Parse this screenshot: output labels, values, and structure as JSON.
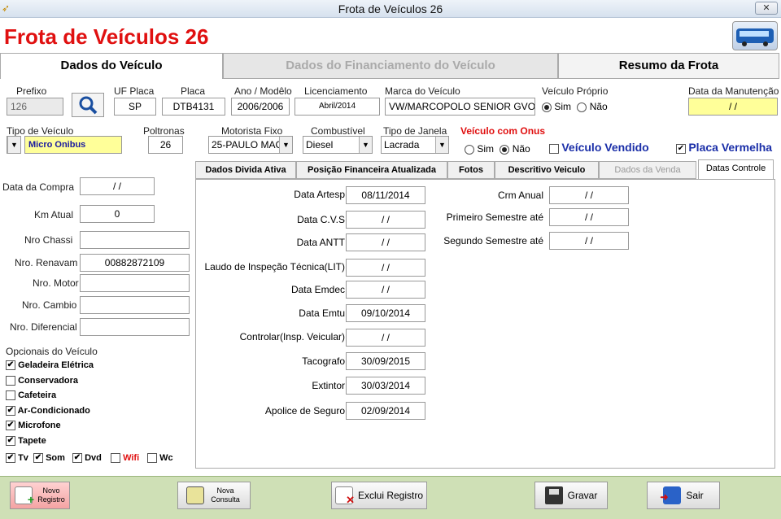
{
  "window": {
    "title": "Frota de Veículos 26",
    "close": "✕"
  },
  "app": {
    "title": "Frota de Veículos 26"
  },
  "tabs": [
    "Dados do Veículo",
    "Dados do Financiamento do Veículo",
    "Resumo da Frota"
  ],
  "header": {
    "prefixo_label": "Prefixo",
    "prefixo": "126",
    "uf_label": "UF Placa",
    "uf": "SP",
    "placa_label": "Placa",
    "placa": "DTB4131",
    "ano_label": "Ano / Modêlo",
    "ano": "2006/2006",
    "lic_label": "Licenciamento",
    "lic": "Abril/2014",
    "marca_label": "Marca do Veículo",
    "marca": "VW/MARCOPOLO SENIOR GVO",
    "proprio_label": "Veículo Próprio",
    "sim": "Sim",
    "nao": "Não",
    "manut_label": "Data da Manutenção",
    "manut": "/ /",
    "tipo_label": "Tipo de Veículo",
    "tipo": "Micro Onibus",
    "poltronas_label": "Poltronas",
    "poltronas": "26",
    "motorista_label": "Motorista Fixo",
    "motorista": "25-PAULO MAC",
    "comb_label": "Combustível",
    "comb": "Diesel",
    "janela_label": "Tipo de Janela",
    "janela": "Lacrada",
    "onus_label": "Veículo com Onus",
    "vendido_label": "Veículo Vendido",
    "placa_vermelha_label": "Placa Vermelha"
  },
  "left": {
    "compra_label": "Data da Compra",
    "compra": "/ /",
    "km_label": "Km Atual",
    "km": "0",
    "chassi_label": "Nro  Chassi",
    "chassi": "",
    "renavam_label": "Nro. Renavam",
    "renavam": "00882872109",
    "motor_label": "Nro. Motor",
    "motor": "",
    "cambio_label": "Nro. Cambio",
    "cambio": "",
    "diferencial_label": "Nro. Diferencial",
    "diferencial": "",
    "opcionais_label": "Opcionais do Veículo",
    "opcionais": [
      {
        "label": "Geladeira Elétrica",
        "checked": true
      },
      {
        "label": "Conservadora",
        "checked": false
      },
      {
        "label": "Cafeteira",
        "checked": false
      },
      {
        "label": "Ar-Condicionado",
        "checked": true
      },
      {
        "label": "Microfone",
        "checked": true
      },
      {
        "label": "Tapete",
        "checked": true
      }
    ],
    "row": [
      {
        "label": "Tv",
        "checked": true
      },
      {
        "label": "Som",
        "checked": true
      },
      {
        "label": "Dvd",
        "checked": true
      },
      {
        "label": "Wifi",
        "checked": false
      },
      {
        "label": "Wc",
        "checked": false
      }
    ]
  },
  "subtabs": [
    "Dados Divida Ativa",
    "Posição Financeira Atualizada",
    "Fotos",
    "Descritivo Veiculo",
    "Dados da Venda",
    "Datas Controle"
  ],
  "datas": [
    {
      "label": "Data Artesp",
      "value": "08/11/2014"
    },
    {
      "label": "Data C.V.S",
      "value": "/ /"
    },
    {
      "label": "Data ANTT",
      "value": "/ /"
    },
    {
      "label": "Laudo de Inspeção Técnica(LIT)",
      "value": "/ /"
    },
    {
      "label": "Data Emdec",
      "value": "/ /"
    },
    {
      "label": "Data Emtu",
      "value": "09/10/2014"
    },
    {
      "label": "Controlar(Insp. Veicular)",
      "value": "/ /"
    },
    {
      "label": "Tacografo",
      "value": "30/09/2015"
    },
    {
      "label": "Extintor",
      "value": "30/03/2014"
    },
    {
      "label": "Apolice de Seguro",
      "value": "02/09/2014"
    }
  ],
  "datas_right": [
    {
      "label": "Crm Anual",
      "value": "/ /"
    },
    {
      "label": "Primeiro Semestre até",
      "value": "/ /"
    },
    {
      "label": "Segundo Semestre até",
      "value": "/ /"
    }
  ],
  "buttons": {
    "novo": "Novo Registro",
    "consulta": "Nova Consulta",
    "exclui": "Exclui Registro",
    "gravar": "Gravar",
    "sair": "Sair"
  }
}
